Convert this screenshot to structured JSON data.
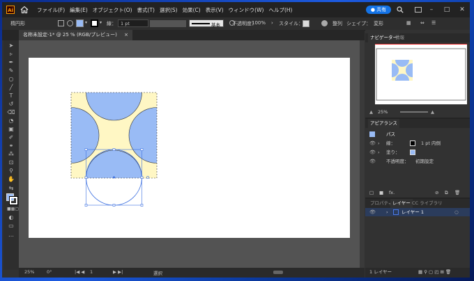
{
  "menu": {
    "items": [
      "ファイル(F)",
      "編集(E)",
      "オブジェクト(O)",
      "書式(T)",
      "選択(S)",
      "効果(C)",
      "表示(V)",
      "ウィンドウ(W)",
      "ヘルプ(H)"
    ],
    "share_label": "共有"
  },
  "control": {
    "selection_label": "楕円形",
    "stroke_label": "線：",
    "stroke_weight": "1 pt",
    "profile_label": "基本",
    "opacity_label": "不透明度：",
    "opacity_value": "100%",
    "style_label": "スタイル：",
    "align_label": "整列",
    "shape_label": "シェイプ：",
    "transform_label": "変形"
  },
  "document": {
    "tab_title": "名称未設定-1* @ 25 % (RGB/プレビュー)",
    "close_symbol": "×"
  },
  "status": {
    "zoom": "25%",
    "rotation": "0°",
    "artboard_number": "1",
    "tool_name": "選択"
  },
  "navigator": {
    "tabs": [
      "ナビゲーター",
      "情報"
    ],
    "zoom": "25%"
  },
  "appearance": {
    "title": "アピアランス",
    "object_type": "パス",
    "stroke_label": "線：",
    "stroke_value": "1 pt  内側",
    "fill_label": "塗り：",
    "opacity_label": "不透明度：",
    "opacity_value": "初期設定",
    "fx_label": "fx."
  },
  "layers": {
    "tabs": [
      "プロパティ",
      "レイヤー",
      "CC ライブラリ"
    ],
    "layer_name": "レイヤー 1",
    "count_label": "1 レイヤー"
  },
  "colors": {
    "fill_blue": "#99bbf5",
    "fill_yellow": "#fff7c4",
    "selection_blue": "#3b6fe0",
    "accent": "#1473e6"
  },
  "icons": [
    "illustrator-logo",
    "home-icon",
    "search-icon",
    "selection-tool-icon",
    "eye-icon"
  ]
}
